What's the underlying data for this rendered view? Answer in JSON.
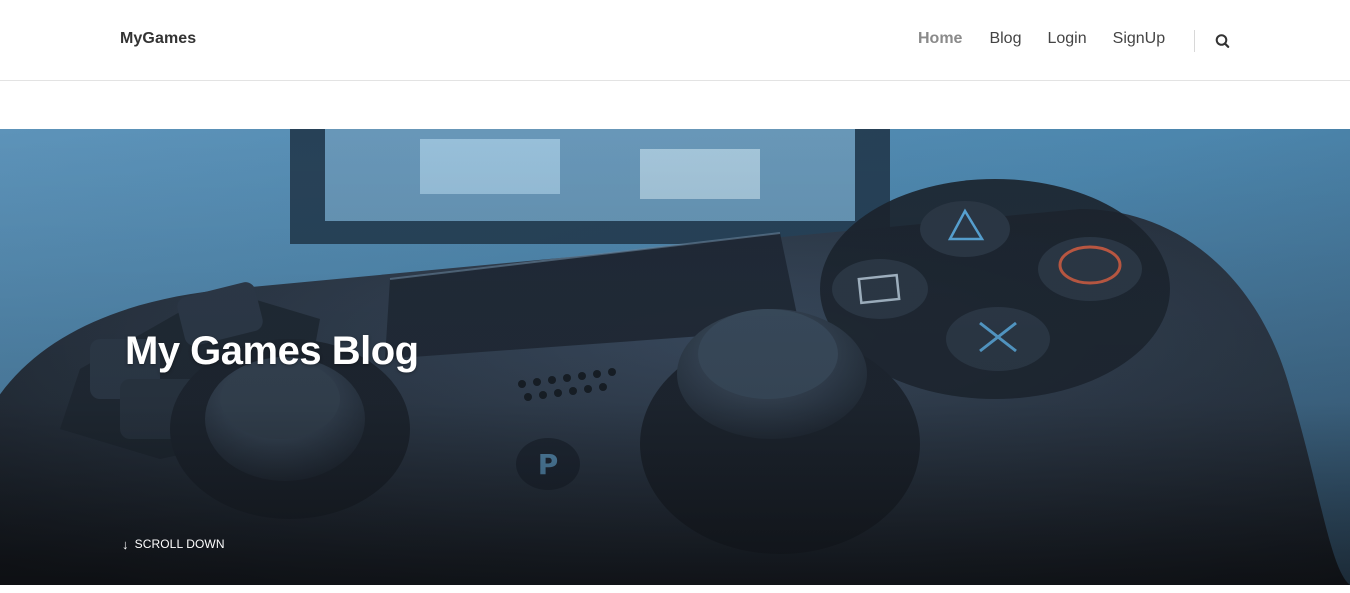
{
  "header": {
    "brand": "MyGames",
    "nav": [
      {
        "label": "Home",
        "active": true
      },
      {
        "label": "Blog",
        "active": false
      },
      {
        "label": "Login",
        "active": false
      },
      {
        "label": "SignUp",
        "active": false
      }
    ],
    "search_icon": "search-icon"
  },
  "hero": {
    "title": "My Games Blog",
    "scroll_label": "SCROLL DOWN",
    "scroll_icon": "arrow-down-icon",
    "background": "gamepad-controller-photo"
  },
  "colors": {
    "nav_active": "#8a8a8a",
    "nav_text": "#444444",
    "brand": "#333333",
    "hero_tint": "#4f8db4",
    "hero_dark": "#1b2430"
  }
}
